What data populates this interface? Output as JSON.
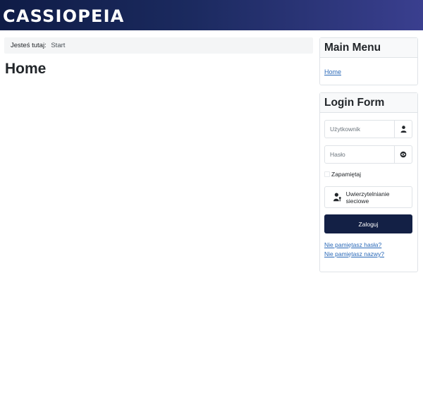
{
  "header": {
    "brand": "CASSIOPEIA"
  },
  "breadcrumb": {
    "label": "Jesteś tutaj:",
    "current": "Start"
  },
  "main": {
    "title": "Home"
  },
  "main_menu": {
    "title": "Main Menu",
    "items": [
      {
        "label": "Home"
      }
    ]
  },
  "login_form": {
    "title": "Login Form",
    "username_placeholder": "Użytkownik",
    "password_placeholder": "Hasło",
    "remember_label": "Zapamiętaj",
    "webauthn_label": "Uwierzytelnianie sieciowe",
    "submit_label": "Zaloguj",
    "forgot_password": "Nie pamiętasz hasła?",
    "forgot_username": "Nie pamiętasz nazwy?"
  },
  "icons": {
    "username_addon": "user-icon",
    "password_addon": "eye-icon",
    "webauthn": "user-key-icon"
  },
  "colors": {
    "header_start": "#0f1c46",
    "header_end": "#3a3f8f",
    "primary_button": "#132045",
    "link": "#2a69b8"
  }
}
